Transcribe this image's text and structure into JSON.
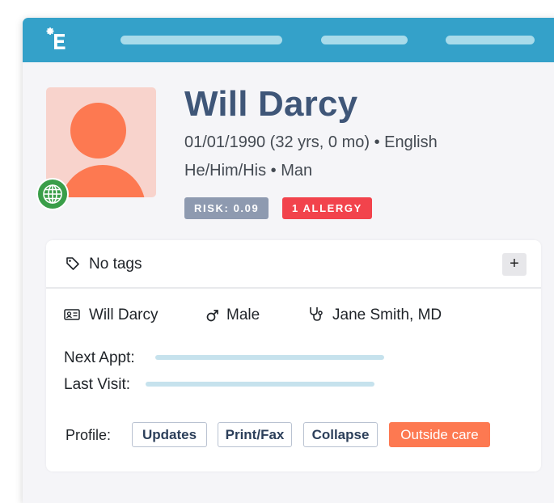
{
  "patient": {
    "name": "Will Darcy",
    "dob_line": "01/01/1990 (32 yrs, 0 mo) • English",
    "identity_line": "He/Him/His • Man",
    "risk_badge": "RISK: 0.09",
    "allergy_badge": "1 ALLERGY"
  },
  "tags": {
    "label": "No tags",
    "add_button": "+"
  },
  "details": {
    "patient_name": "Will Darcy",
    "sex": "Male",
    "provider": "Jane Smith, MD",
    "next_appt_label": "Next Appt:",
    "last_visit_label": "Last Visit:"
  },
  "profile": {
    "label": "Profile:",
    "buttons": {
      "updates": "Updates",
      "print_fax": "Print/Fax",
      "collapse": "Collapse",
      "outside_care": "Outside care"
    }
  },
  "colors": {
    "topbar": "#34a1c9",
    "name": "#3f5678",
    "risk_badge": "#8e9ab0",
    "allergy_badge": "#f2434c",
    "outside_care": "#fd7951",
    "avatar": "#fd7951",
    "globe_badge": "#3a9e49"
  }
}
